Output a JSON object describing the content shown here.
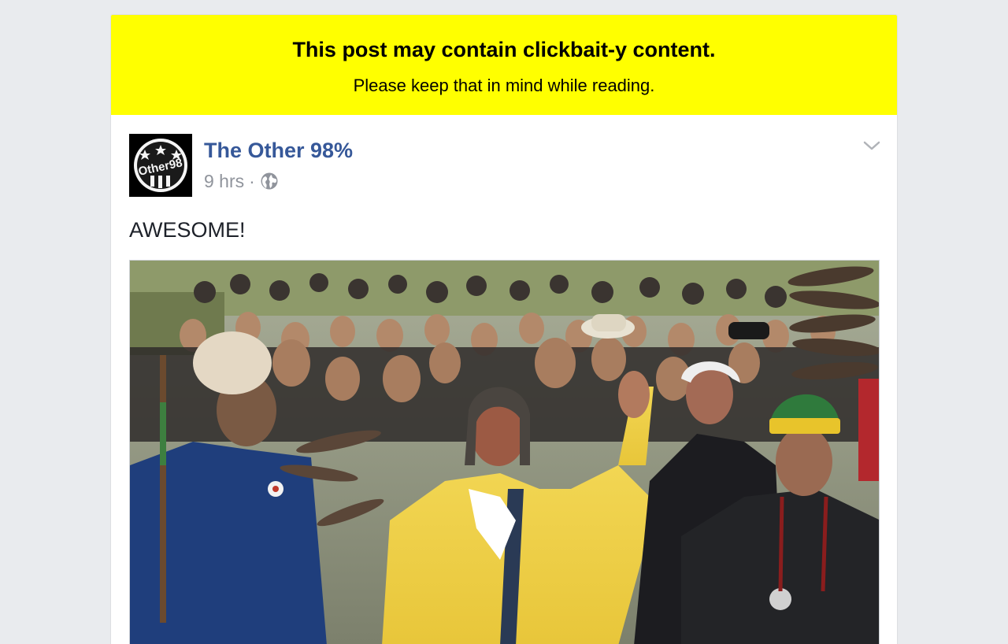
{
  "banner": {
    "title": "This post may contain clickbait-y content.",
    "subtitle": "Please keep that in mind while reading.",
    "background": "#ffff00"
  },
  "post": {
    "page_name": "The Other 98%",
    "page_name_color": "#365899",
    "time": "9 hrs",
    "separator": "·",
    "privacy_icon": "globe-icon",
    "menu_icon": "chevron-down-icon",
    "text": "AWESOME!",
    "avatar_logo_text": "Other98",
    "photo_subject": "crowd-march-photo"
  }
}
